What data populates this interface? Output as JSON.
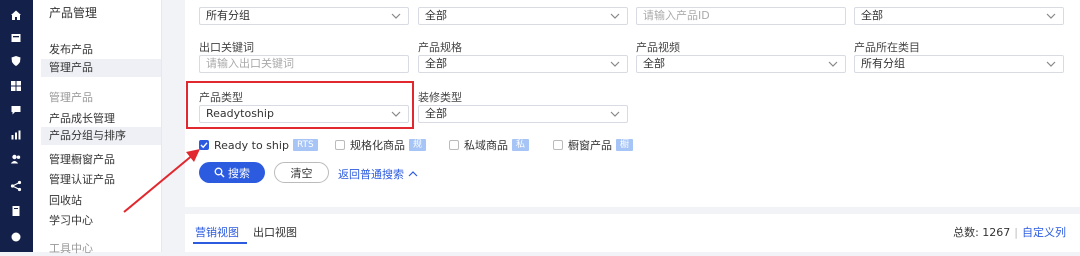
{
  "nav_icons": [
    "home-icon",
    "box-icon",
    "shield-icon",
    "grid-icon",
    "chat-icon",
    "chart-icon",
    "users-icon",
    "share-icon",
    "document-icon",
    "circle-icon"
  ],
  "sidebar": {
    "title": "产品管理",
    "items1": [
      "发布产品",
      "管理产品"
    ],
    "section2": "管理产品",
    "items2": [
      "产品成长管理",
      "产品分组与排序",
      "管理橱窗产品",
      "管理认证产品",
      "回收站",
      "学习中心"
    ],
    "section3": "工具中心"
  },
  "filters": {
    "row0": [
      "所有分组",
      "全部",
      "请输入产品ID",
      "全部"
    ],
    "row1_labels": [
      "出口关键词",
      "产品规格",
      "产品视频",
      "产品所在类目"
    ],
    "row1_values": [
      "请输入出口关键词",
      "全部",
      "全部",
      "所有分组"
    ],
    "row2_labels": [
      "产品类型",
      "装修类型"
    ],
    "row2_values": [
      "Readytoship",
      "全部"
    ]
  },
  "checkboxes": [
    {
      "label": "Ready to ship",
      "tag": "RTS",
      "checked": true
    },
    {
      "label": "规格化商品",
      "tag": "规",
      "checked": false
    },
    {
      "label": "私域商品",
      "tag": "私",
      "checked": false
    },
    {
      "label": "橱窗产品",
      "tag": "橱",
      "checked": false
    }
  ],
  "actions": {
    "search": "搜索",
    "clear": "清空",
    "back": "返回普通搜索"
  },
  "tabs": [
    "营销视图",
    "出口视图"
  ],
  "footer": {
    "total": "总数: 1267",
    "custom_columns": "自定义列"
  },
  "colors": {
    "accent": "#2c5be0",
    "highlight": "#e0282e",
    "leftbar": "#13204a"
  }
}
